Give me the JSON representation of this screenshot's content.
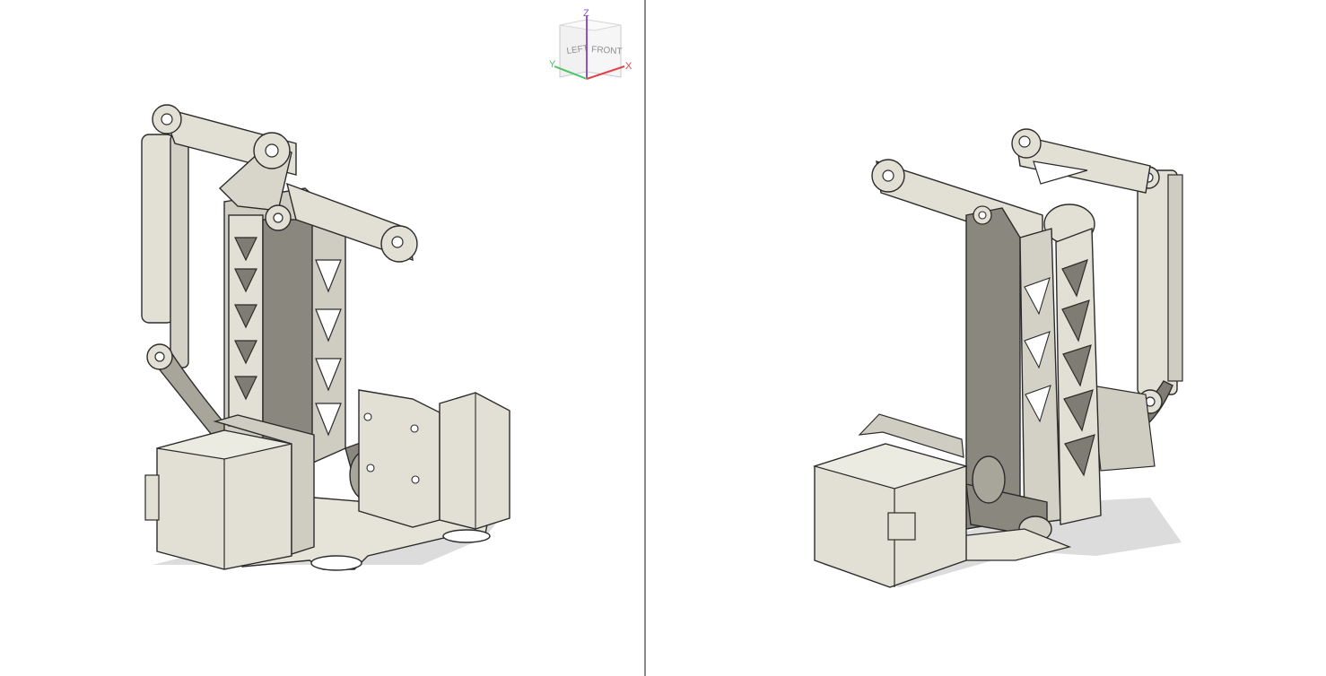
{
  "viewcube": {
    "faces": {
      "left": "LEFT",
      "front": "FRONT"
    },
    "axes": {
      "x": "X",
      "y": "Y",
      "z": "Z"
    },
    "colors": {
      "x": "#e0434a",
      "y": "#4cc26a",
      "z": "#8a4fe0"
    }
  },
  "viewports": [
    {
      "name": "left-view",
      "model": "robot-arm-assembly-front-left"
    },
    {
      "name": "right-view",
      "model": "robot-arm-assembly-back-right"
    }
  ],
  "colors": {
    "model_fill": "#e2e0d4",
    "model_shade": "#bebbae",
    "model_dark": "#8c8a80",
    "edge": "#2b2b2b",
    "shadow": "#d4d4d4",
    "background": "#ffffff",
    "divider": "#8a8a8a"
  }
}
